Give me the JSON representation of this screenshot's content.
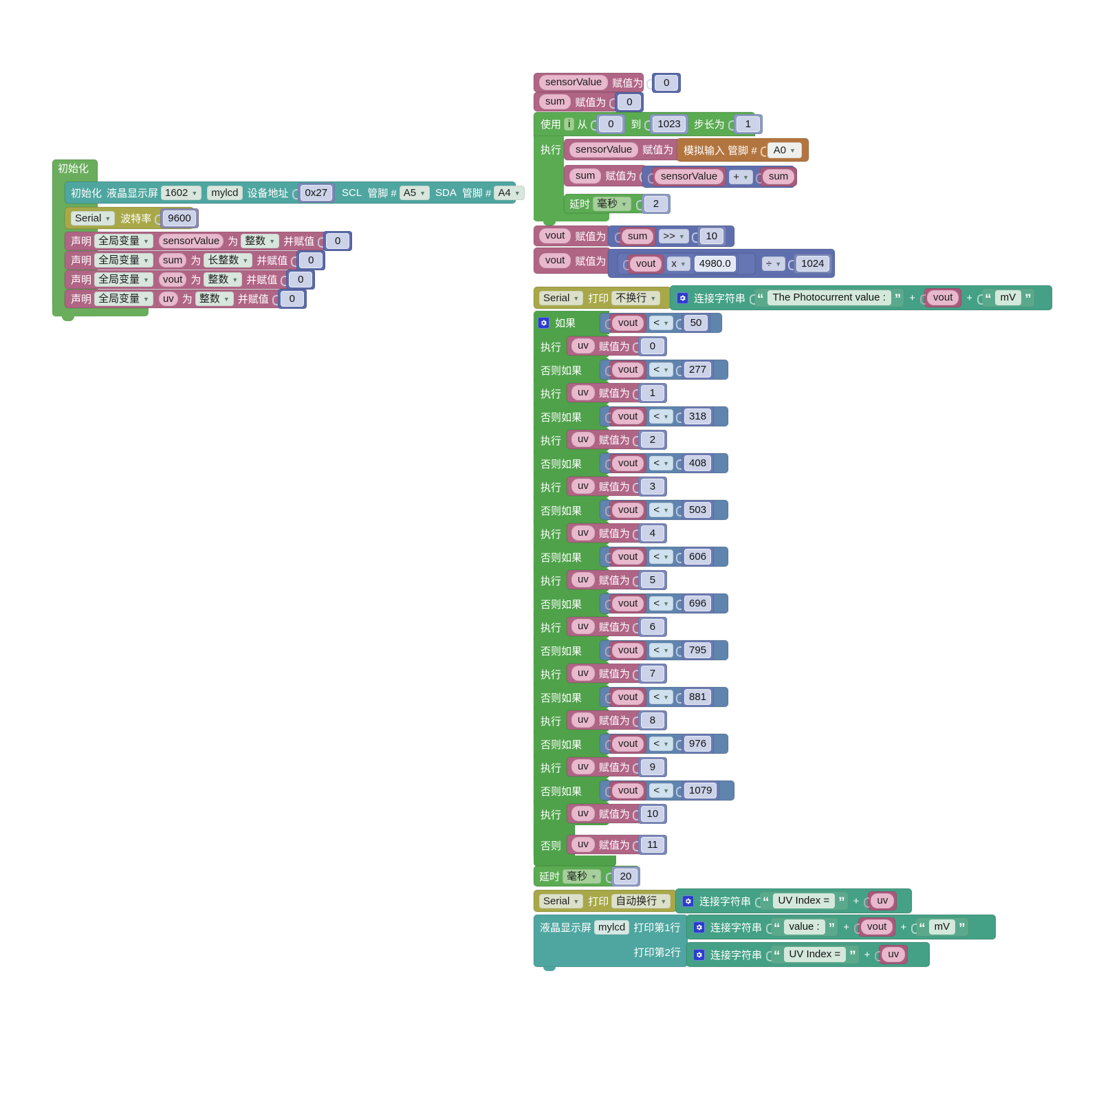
{
  "app": {
    "type": "blockly-visual-programming",
    "language": "zh-CN"
  },
  "palette": {
    "setup_green": "#6aad5c",
    "lcd_teal": "#4fa6a0",
    "serial_olive": "#a8a849",
    "variable_mauve": "#b06585",
    "loop_green": "#5aab52",
    "math_blue": "#5f6fae",
    "analog_brown": "#b3753f",
    "text_teal": "#44a186",
    "logic_blue": "#5f84ae",
    "if_green": "#4fa24a"
  },
  "setup_stack": {
    "header_label": "初始化",
    "lcd_init": {
      "label_init": "初始化",
      "label_lcd": "液晶显示屏",
      "lcd_type": "1602",
      "lcd_name": "mylcd",
      "label_addr": "设备地址",
      "addr_value": "0x27",
      "label_scl": "SCL",
      "label_pin1": "管脚 #",
      "scl_pin": "A5",
      "label_sda": "SDA",
      "label_pin2": "管脚 #",
      "sda_pin": "A4"
    },
    "serial_begin": {
      "port": "Serial",
      "label_baud": "波特率",
      "baud": "9600"
    },
    "declarations": [
      {
        "label_declare": "声明",
        "scope": "全局变量",
        "name": "sensorValue",
        "label_as": "为",
        "type": "整数",
        "label_assign": "并赋值",
        "value": "0"
      },
      {
        "label_declare": "声明",
        "scope": "全局变量",
        "name": "sum",
        "label_as": "为",
        "type": "长整数",
        "label_assign": "并赋值",
        "value": "0"
      },
      {
        "label_declare": "声明",
        "scope": "全局变量",
        "name": "vout",
        "label_as": "为",
        "type": "整数",
        "label_assign": "并赋值",
        "value": "0"
      },
      {
        "label_declare": "声明",
        "scope": "全局变量",
        "name": "uv",
        "label_as": "为",
        "type": "整数",
        "label_assign": "并赋值",
        "value": "0"
      }
    ]
  },
  "loop_stack": {
    "set_sensorvalue_0": {
      "var": "sensorValue",
      "label": "赋值为",
      "value": "0"
    },
    "set_sum_0": {
      "var": "sum",
      "label": "赋值为",
      "value": "0"
    },
    "for_loop": {
      "label_use": "使用",
      "counter": "i",
      "label_from": "从",
      "from": "0",
      "label_to": "到",
      "to": "1023",
      "label_step": "步长为",
      "step": "1",
      "label_do": "执行",
      "body": {
        "read_analog": {
          "var": "sensorValue",
          "label": "赋值为",
          "block_label": "模拟输入 管脚 #",
          "pin": "A0"
        },
        "accumulate": {
          "var": "sum",
          "label": "赋值为",
          "left": "sensorValue",
          "operator": "+",
          "right": "sum"
        },
        "delay": {
          "label": "延时",
          "unit": "毫秒",
          "value": "2"
        }
      }
    },
    "vout_shift": {
      "var": "vout",
      "label": "赋值为",
      "left": "sum",
      "operator": ">>",
      "right": "10"
    },
    "vout_scale": {
      "var": "vout",
      "label": "赋值为",
      "left": "vout",
      "op1": "x",
      "mid": "4980.0",
      "op2": "÷",
      "right": "1024"
    },
    "serial_print_photocurrent": {
      "port": "Serial",
      "label_print": "打印",
      "mode": "不换行",
      "join_label": "连接字符串",
      "text": "The Photocurrent value :",
      "plus1": "+",
      "var": "vout",
      "plus2": "+",
      "unit": "mV"
    },
    "if_chain": {
      "label_if": "如果",
      "label_do": "执行",
      "label_elseif": "否则如果",
      "label_else": "否则",
      "label_assign": "赋值为",
      "condition_var": "vout",
      "operator": "<",
      "target_var": "uv",
      "branches": [
        {
          "kind": "if",
          "threshold": "50",
          "uv": "0"
        },
        {
          "kind": "elseif",
          "threshold": "277",
          "uv": "1"
        },
        {
          "kind": "elseif",
          "threshold": "318",
          "uv": "2"
        },
        {
          "kind": "elseif",
          "threshold": "408",
          "uv": "3"
        },
        {
          "kind": "elseif",
          "threshold": "503",
          "uv": "4"
        },
        {
          "kind": "elseif",
          "threshold": "606",
          "uv": "5"
        },
        {
          "kind": "elseif",
          "threshold": "696",
          "uv": "6"
        },
        {
          "kind": "elseif",
          "threshold": "795",
          "uv": "7"
        },
        {
          "kind": "elseif",
          "threshold": "881",
          "uv": "8"
        },
        {
          "kind": "elseif",
          "threshold": "976",
          "uv": "9"
        },
        {
          "kind": "elseif",
          "threshold": "1079",
          "uv": "10"
        }
      ],
      "else_uv": "11"
    },
    "delay_20": {
      "label": "延时",
      "unit": "毫秒",
      "value": "20"
    },
    "serial_print_uvindex": {
      "port": "Serial",
      "label_print": "打印",
      "mode": "自动换行",
      "join_label": "连接字符串",
      "text": "UV Index = ",
      "plus1": "+",
      "var": "uv"
    },
    "lcd_print": {
      "label_lcd": "液晶显示屏",
      "lcd_name": "mylcd",
      "label_line1": "打印第1行",
      "label_line2": "打印第2行",
      "line1": {
        "join_label": "连接字符串",
        "text": "value :",
        "plus1": "+",
        "var": "vout",
        "plus2": "+",
        "unit": "mV"
      },
      "line2": {
        "join_label": "连接字符串",
        "text": "UV Index = ",
        "plus1": "+",
        "var": "uv"
      }
    }
  }
}
